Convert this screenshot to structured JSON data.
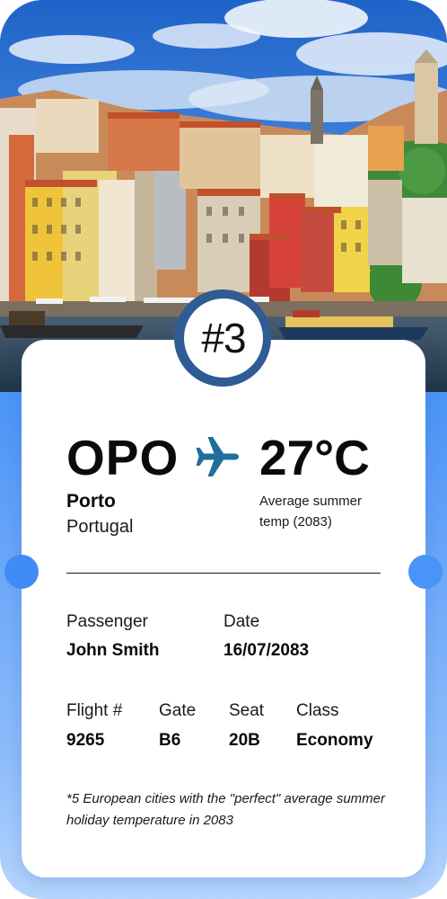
{
  "badge": {
    "number": "#3"
  },
  "flight": {
    "airport_code": "OPO",
    "city": "Porto",
    "country": "Portugal",
    "temperature": "27°C",
    "temperature_note": "Average summer temp (2083)"
  },
  "details": {
    "passenger_label": "Passenger",
    "passenger_value": "John Smith",
    "date_label": "Date",
    "date_value": "16/07/2083",
    "flight_label": "Flight #",
    "flight_value": "9265",
    "gate_label": "Gate",
    "gate_value": "B6",
    "seat_label": "Seat",
    "seat_value": "20B",
    "class_label": "Class",
    "class_value": "Economy"
  },
  "footnote": "*5 European cities with the \"perfect\" average summer holiday temperature in 2083",
  "icons": {
    "plane": "airplane-icon"
  },
  "colors": {
    "background_blue": "#2a7ff5",
    "plane_teal": "#1f6f9a",
    "badge_ring": "#2e5c93"
  }
}
